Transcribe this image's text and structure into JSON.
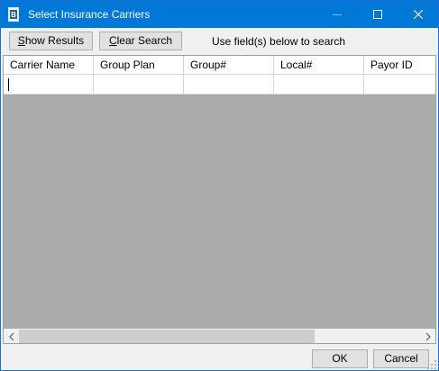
{
  "window": {
    "title": "Select Insurance Carriers"
  },
  "toolbar": {
    "show_results_label": "Show Results",
    "show_results_mnemonic": "S",
    "show_results_rest": "how Results",
    "clear_search_label": "Clear Search",
    "clear_search_mnemonic": "C",
    "clear_search_rest": "lear Search",
    "hint": "Use field(s) below to search"
  },
  "grid": {
    "columns": [
      {
        "header": "Carrier Name",
        "filter_value": ""
      },
      {
        "header": "Group Plan",
        "filter_value": ""
      },
      {
        "header": "Group#",
        "filter_value": ""
      },
      {
        "header": "Local#",
        "filter_value": ""
      },
      {
        "header": "Payor ID",
        "filter_value": ""
      }
    ],
    "rows": []
  },
  "footer": {
    "ok_label": "OK",
    "ok_mnemonic": "O",
    "ok_rest": "K",
    "cancel_label": "Cancel",
    "cancel_before": "Cance",
    "cancel_mnemonic": "l"
  },
  "icons": {
    "app": "app-icon",
    "minimize": "minimize-icon",
    "maximize": "maximize-icon",
    "close": "close-icon",
    "scroll_left": "scroll-left-arrow-icon",
    "scroll_right": "scroll-right-arrow-icon",
    "resize": "resize-grip-icon"
  },
  "colors": {
    "titlebar": "#0078d7",
    "grid_empty": "#ababab",
    "window_bg": "#f0f0f0"
  }
}
